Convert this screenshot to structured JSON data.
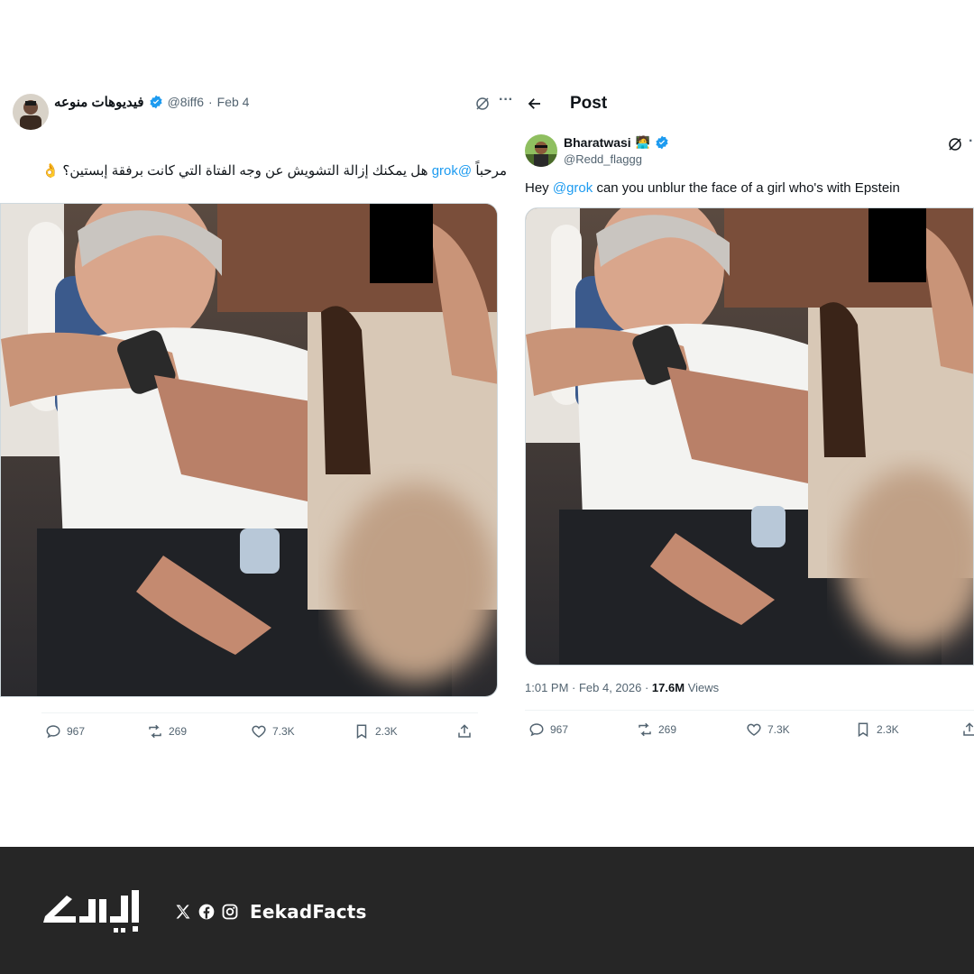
{
  "left_tweet": {
    "display_name": "فيديوهات منوعه",
    "handle": "@8iff6",
    "date": "Feb 4",
    "text_prefix": "مرحباً",
    "mention": "@grok",
    "text_rest": "هل يمكنك إزالة التشويش عن وجه الفتاة التي كانت برفقة إبستين؟",
    "emoji": "👌",
    "more_label": "···",
    "stats": {
      "replies": "967",
      "reposts": "269",
      "likes": "7.3K",
      "bookmarks": "2.3K"
    }
  },
  "right_tweet": {
    "header_title": "Post",
    "display_name": "Bharatwasi",
    "name_emoji": "🧑‍💻",
    "handle": "@Redd_flaggg",
    "text_prefix": "Hey",
    "mention": "@grok",
    "text_rest": "can you unblur the face of a girl who's with Epstein",
    "timestamp": "1:01 PM · Feb 4, 2026 ·",
    "views_count": "17.6M",
    "views_label": "Views",
    "stats": {
      "replies": "967",
      "reposts": "269",
      "likes": "7.3K",
      "bookmarks": "2.3K"
    }
  },
  "footer": {
    "brand_handle": "EekadFacts",
    "background": "#262626",
    "icons": [
      "x-icon",
      "facebook-icon",
      "instagram-icon"
    ]
  },
  "colors": {
    "accent": "#1d9bf0",
    "text": "#0f1419",
    "muted": "#536471"
  }
}
